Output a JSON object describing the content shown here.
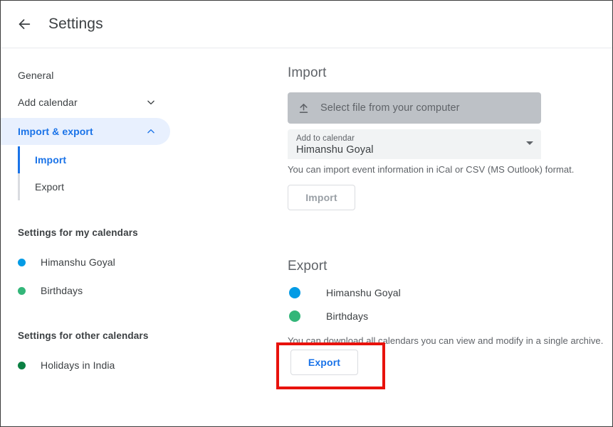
{
  "header": {
    "back_icon": "arrow-left-icon",
    "title": "Settings"
  },
  "sidebar": {
    "items": [
      {
        "label": "General",
        "icon": null
      },
      {
        "label": "Add calendar",
        "icon": "chevron-down-icon"
      },
      {
        "label": "Import & export",
        "icon": "chevron-up-icon"
      }
    ],
    "subitems": [
      {
        "label": "Import",
        "active": true
      },
      {
        "label": "Export",
        "active": false
      }
    ],
    "my_calendars_heading": "Settings for my calendars",
    "my_calendars": [
      {
        "name": "Himanshu Goyal",
        "color": "#039be5"
      },
      {
        "name": "Birthdays",
        "color": "#33b679"
      }
    ],
    "other_calendars_heading": "Settings for other calendars",
    "other_calendars": [
      {
        "name": "Holidays in India",
        "color": "#0b8043"
      }
    ]
  },
  "import": {
    "title": "Import",
    "file_button_label": "Select file from your computer",
    "file_button_icon": "upload-icon",
    "select_label": "Add to calendar",
    "select_value": "Himanshu Goyal",
    "helper_text": "You can import event information in iCal or CSV (MS Outlook) format.",
    "button_label": "Import"
  },
  "export": {
    "title": "Export",
    "calendars": [
      {
        "name": "Himanshu Goyal",
        "color": "#039be5"
      },
      {
        "name": "Birthdays",
        "color": "#33b679"
      }
    ],
    "helper_text": "You can download all calendars you can view and modify in a single archive.",
    "button_label": "Export"
  },
  "colors": {
    "accent_blue": "#1a73e8",
    "highlight_pill": "#e8f0fe",
    "annotation_red": "#e8120c"
  }
}
